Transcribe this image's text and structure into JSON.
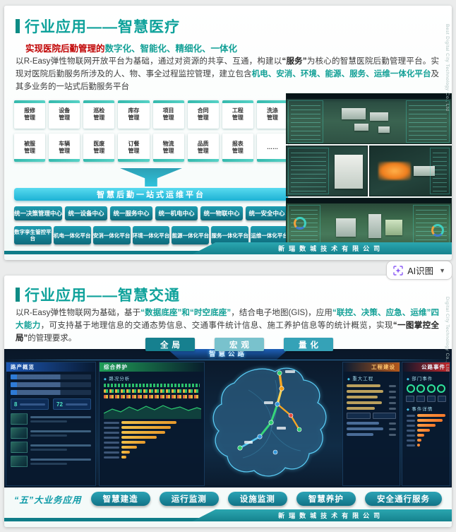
{
  "colors": {
    "accent_teal": "#12a096",
    "accent_red": "#c00000",
    "cyan_bar": "#1db2d5",
    "dashboard_bg": "#0a1728"
  },
  "ai_button": {
    "label": "AI识图"
  },
  "slide1": {
    "title": "行业应用——智慧医疗",
    "subtitle": {
      "red": "实现医院后勤管理的",
      "teal": "数字化、智能化、精细化、一体化"
    },
    "paragraph": [
      {
        "t": "以R-Easy弹性物联网开放平台为基础，通过对资源的共享、互通，构建以"
      },
      {
        "t": "“服务”"
      },
      {
        "t": "为核心的智慧医院后勤管理平台。实现对医院后勤服务所涉及的人、物、事全过程监控管理，建立包含"
      },
      {
        "t": "机电、安消、环境、能源、服务、运维一体化平台"
      },
      {
        "t": "及其多业务的一站式后勤服务平台"
      }
    ],
    "modules_row1": [
      "报修管理",
      "设备管理",
      "巡检管理",
      "库存管理",
      "项目管理",
      "合同管理",
      "工程管理",
      "洗涤管理"
    ],
    "modules_row2": [
      "被服管理",
      "车辆管理",
      "医废管理",
      "订餐管理",
      "物流管理",
      "品质管理",
      "报表管理",
      "……"
    ],
    "platform_bar": "智慧后勤一站式运维平台",
    "centers": [
      "统一决策管理中心",
      "统一设备中心",
      "统一服务中心",
      "统一机电中心",
      "统一物联中心",
      "统一安全中心"
    ],
    "platforms": [
      "数字孪生管控平台",
      "机电一体化平台",
      "安消一体化平台",
      "环境一体化平台",
      "能源一体化平台",
      "服务一体化平台",
      "运维一体化平台"
    ],
    "side_text": "Best Digital City Technology Co., Ltd",
    "company": "新瑞数城技术有限公司"
  },
  "slide2": {
    "title": "行业应用——智慧交通",
    "paragraph": [
      {
        "t": "以R-Easy弹性物联网为基础，基于"
      },
      {
        "t": "“数据底座”和“时空底座”"
      },
      {
        "t": "，结合电子地图(GIS)，应用"
      },
      {
        "t": "“联控、决策、应急、运维”四大能力"
      },
      {
        "t": "，可支持基于地理信息的交通态势信息、交通事件统计信息、施工养护信息等的统计概览，实现"
      },
      {
        "t": "“一图掌控全局”"
      },
      {
        "t": "的管理要求。"
      }
    ],
    "view_buttons": [
      "全局",
      "宏观",
      "量化"
    ],
    "dashboard": {
      "title": "智慧公路",
      "panel_left1": "路产概览",
      "panel_left2": "综合养护",
      "panel_right1": "工程建设",
      "panel_right2": "公路事件",
      "sub_road_analysis": "路况分析",
      "sub_major_projects": "重大工程",
      "sub_dept_events": "部门事件",
      "sub_event_detail": "事件详情",
      "stat1": "8",
      "stat2": "72"
    },
    "bottom_label": "“五”大业务应用",
    "services": [
      "智慧建造",
      "运行监测",
      "设施监测",
      "智慧养护",
      "安全通行服务"
    ],
    "side_text": "Digital City Technology Co., Ltd",
    "company": "新瑞数城技术有限公司"
  }
}
